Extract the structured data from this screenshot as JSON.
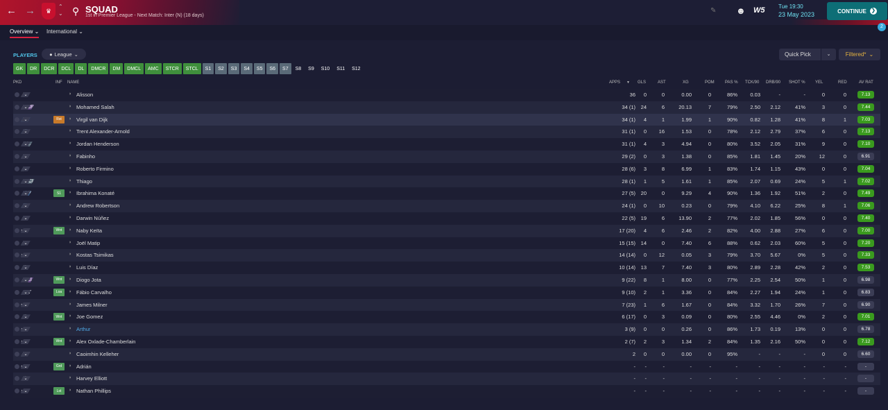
{
  "header": {
    "title": "SQUAD",
    "subtitle": "1st in Premier League - Next Match: Inter (N) (18 days)",
    "time": "Tue 19:30",
    "date": "23 May 2023",
    "continue_label": "CONTINUE",
    "brand_label": "W5",
    "notification_count": "2",
    "back_icon": "arrow-left-icon",
    "forward_icon": "arrow-right-icon"
  },
  "tabs": [
    {
      "label": "Overview ⌄"
    },
    {
      "label": "International ⌄"
    }
  ],
  "toolbar": {
    "players_label": "PLAYERS",
    "league_label": "League",
    "quick_pick_label": "Quick Pick",
    "filtered_label": "Filtered*"
  },
  "position_filters": [
    "GK",
    "DR",
    "DCR",
    "DCL",
    "DL",
    "DMCR",
    "DM",
    "DMCL",
    "AMC",
    "STCR",
    "STCL",
    "S1",
    "S2",
    "S3",
    "S4",
    "S5",
    "S6",
    "S7",
    "S8",
    "S9",
    "S10",
    "S11",
    "S12"
  ],
  "columns": {
    "pkd": "PKD",
    "inf": "INF",
    "name": "NAME",
    "apps": "APPS",
    "gls": "GLS",
    "ast": "AST",
    "xg": "XG",
    "pom": "POM",
    "pas": "PAS %",
    "tck": "TCK/90",
    "drb": "DRB/90",
    "shot": "SHOT %",
    "yel": "YEL",
    "red": "RED",
    "avrat": "AV RAT"
  },
  "colors": {
    "green": "#3f8f3c",
    "grey": "#5a6a78",
    "rating_high": "#3a9a1e",
    "rating_low": "#3b3d55",
    "accent": "#d8213f"
  },
  "players": [
    {
      "pkd": "GK",
      "pk_color": "#6b6150",
      "inf": "",
      "name": "Alisson",
      "apps": "36",
      "gls": "0",
      "ast": "0",
      "xg": "0.00",
      "pom": "0",
      "pas": "86%",
      "tck": "0.03",
      "drb": "-",
      "shot": "-",
      "yel": "0",
      "red": "0",
      "rat": "7.13",
      "hi": true
    },
    {
      "pkd": "STCR",
      "pk_color": "#6a4f8a",
      "inf": "",
      "name": "Mohamed Salah",
      "apps": "34 (1)",
      "gls": "24",
      "ast": "6",
      "xg": "20.13",
      "pom": "7",
      "pas": "79%",
      "tck": "2.50",
      "drb": "2.12",
      "shot": "41%",
      "yel": "3",
      "red": "0",
      "rat": "7.44",
      "hi": true
    },
    {
      "pkd": "DCL",
      "pk_color": "#3d6fa3",
      "inf": "Rst",
      "inf_color": "#c87a2a",
      "name": "Virgil van Dijk",
      "apps": "34 (1)",
      "gls": "4",
      "ast": "1",
      "xg": "1.99",
      "pom": "1",
      "pas": "90%",
      "tck": "0.82",
      "drb": "1.28",
      "shot": "41%",
      "yel": "8",
      "red": "1",
      "rat": "7.03",
      "hi": true,
      "sel": true
    },
    {
      "pkd": "DR",
      "pk_color": "#3d6fa3",
      "inf": "",
      "name": "Trent Alexander-Arnold",
      "apps": "31 (1)",
      "gls": "0",
      "ast": "16",
      "xg": "1.53",
      "pom": "0",
      "pas": "78%",
      "tck": "2.12",
      "drb": "2.79",
      "shot": "37%",
      "yel": "6",
      "red": "0",
      "rat": "7.13",
      "hi": true
    },
    {
      "pkd": "DM...",
      "pk_color": "#5a6a78",
      "inf": "",
      "name": "Jordan Henderson",
      "apps": "31 (1)",
      "gls": "4",
      "ast": "3",
      "xg": "4.94",
      "pom": "0",
      "pas": "80%",
      "tck": "3.52",
      "drb": "2.05",
      "shot": "31%",
      "yel": "9",
      "red": "0",
      "rat": "7.10",
      "hi": true
    },
    {
      "pkd": "DM",
      "pk_color": "#5a6a78",
      "inf": "",
      "name": "Fabinho",
      "apps": "29 (2)",
      "gls": "0",
      "ast": "3",
      "xg": "1.38",
      "pom": "0",
      "pas": "85%",
      "tck": "1.81",
      "drb": "1.45",
      "shot": "20%",
      "yel": "12",
      "red": "0",
      "rat": "6.91",
      "hi": false
    },
    {
      "pkd": "S7",
      "pk_color": "#5a6a78",
      "inf": "",
      "name": "Roberto Firmino",
      "apps": "28 (6)",
      "gls": "3",
      "ast": "8",
      "xg": "6.99",
      "pom": "1",
      "pas": "83%",
      "tck": "1.74",
      "drb": "1.15",
      "shot": "43%",
      "yel": "0",
      "red": "0",
      "rat": "7.04",
      "hi": true
    },
    {
      "pkd": "DMCL",
      "pk_color": "#5a6a78",
      "inf": "",
      "name": "Thiago",
      "apps": "28 (1)",
      "gls": "1",
      "ast": "5",
      "xg": "1.61",
      "pom": "1",
      "pas": "85%",
      "tck": "2.07",
      "drb": "0.69",
      "shot": "24%",
      "yel": "5",
      "red": "1",
      "rat": "7.02",
      "hi": true
    },
    {
      "pkd": "DCR",
      "pk_color": "#3d6fa3",
      "inf": "S1",
      "inf_color": "#4f9a5a",
      "name": "Ibrahima Konaté",
      "apps": "27 (5)",
      "gls": "20",
      "ast": "0",
      "xg": "9.29",
      "pom": "4",
      "pas": "90%",
      "tck": "1.36",
      "drb": "1.92",
      "shot": "51%",
      "yel": "2",
      "red": "0",
      "rat": "7.49",
      "hi": true
    },
    {
      "pkd": "DL",
      "pk_color": "#3d6fa3",
      "inf": "",
      "name": "Andrew Robertson",
      "apps": "24 (1)",
      "gls": "0",
      "ast": "10",
      "xg": "0.23",
      "pom": "0",
      "pas": "79%",
      "tck": "4.10",
      "drb": "6.22",
      "shot": "25%",
      "yel": "8",
      "red": "1",
      "rat": "7.06",
      "hi": true
    },
    {
      "pkd": "S4",
      "pk_color": "#5a6a78",
      "inf": "",
      "name": "Darwin Núñez",
      "apps": "22 (5)",
      "gls": "19",
      "ast": "6",
      "xg": "13.90",
      "pom": "2",
      "pas": "77%",
      "tck": "2.02",
      "drb": "1.85",
      "shot": "56%",
      "yel": "0",
      "red": "0",
      "rat": "7.40",
      "hi": true
    },
    {
      "pkd": "-",
      "pk_color": "#3a3c52",
      "inf": "Wnt",
      "inf_color": "#4f9a5a",
      "name": "Naby Keïta",
      "apps": "17 (20)",
      "gls": "4",
      "ast": "6",
      "xg": "2.46",
      "pom": "2",
      "pas": "82%",
      "tck": "4.00",
      "drb": "2.88",
      "shot": "27%",
      "yel": "6",
      "red": "0",
      "rat": "7.00",
      "hi": true
    },
    {
      "pkd": "S2",
      "pk_color": "#5a6a78",
      "inf": "",
      "name": "Joël Matip",
      "apps": "15 (15)",
      "gls": "14",
      "ast": "0",
      "xg": "7.40",
      "pom": "6",
      "pas": "88%",
      "tck": "0.62",
      "drb": "2.03",
      "shot": "60%",
      "yel": "5",
      "red": "0",
      "rat": "7.20",
      "hi": true
    },
    {
      "pkd": "-",
      "pk_color": "#3a3c52",
      "inf": "",
      "name": "Kostas Tsimikas",
      "apps": "14 (14)",
      "gls": "0",
      "ast": "12",
      "xg": "0.05",
      "pom": "3",
      "pas": "79%",
      "tck": "3.70",
      "drb": "5.67",
      "shot": "0%",
      "yel": "5",
      "red": "0",
      "rat": "7.33",
      "hi": true
    },
    {
      "pkd": "S3",
      "pk_color": "#5a6a78",
      "inf": "",
      "name": "Luis Díaz",
      "apps": "10 (14)",
      "gls": "13",
      "ast": "7",
      "xg": "7.40",
      "pom": "3",
      "pas": "80%",
      "tck": "2.89",
      "drb": "2.28",
      "shot": "42%",
      "yel": "2",
      "red": "0",
      "rat": "7.53",
      "hi": true
    },
    {
      "pkd": "STCL",
      "pk_color": "#6a4f8a",
      "inf": "Wnt",
      "inf_color": "#4f9a5a",
      "name": "Diogo Jota",
      "apps": "9 (22)",
      "gls": "8",
      "ast": "1",
      "xg": "8.00",
      "pom": "0",
      "pas": "77%",
      "tck": "2.25",
      "drb": "2.54",
      "shot": "50%",
      "yel": "1",
      "red": "0",
      "rat": "6.98",
      "hi": false
    },
    {
      "pkd": "AMC",
      "pk_color": "#3a3c52",
      "inf": "Loa",
      "inf_color": "#4f9a5a",
      "name": "Fábio Carvalho",
      "apps": "9 (10)",
      "gls": "2",
      "ast": "1",
      "xg": "3.36",
      "pom": "0",
      "pas": "84%",
      "tck": "2.27",
      "drb": "1.94",
      "shot": "24%",
      "yel": "1",
      "red": "0",
      "rat": "6.83",
      "hi": false
    },
    {
      "pkd": "-",
      "pk_color": "#3a3c52",
      "inf": "",
      "name": "James Milner",
      "apps": "7 (23)",
      "gls": "1",
      "ast": "6",
      "xg": "1.67",
      "pom": "0",
      "pas": "84%",
      "tck": "3.32",
      "drb": "1.70",
      "shot": "26%",
      "yel": "7",
      "red": "0",
      "rat": "6.90",
      "hi": false
    },
    {
      "pkd": "S5",
      "pk_color": "#5a6a78",
      "inf": "Wnt",
      "inf_color": "#4f9a5a",
      "name": "Joe Gomez",
      "apps": "6 (17)",
      "gls": "0",
      "ast": "3",
      "xg": "0.09",
      "pom": "0",
      "pas": "80%",
      "tck": "2.55",
      "drb": "4.46",
      "shot": "0%",
      "yel": "2",
      "red": "0",
      "rat": "7.01",
      "hi": true
    },
    {
      "pkd": "-",
      "pk_color": "#3a3c52",
      "inf": "",
      "name": "Arthur",
      "name_blue": true,
      "apps": "3 (9)",
      "gls": "0",
      "ast": "0",
      "xg": "0.26",
      "pom": "0",
      "pas": "86%",
      "tck": "1.73",
      "drb": "0.19",
      "shot": "13%",
      "yel": "0",
      "red": "0",
      "rat": "6.78",
      "hi": false
    },
    {
      "pkd": "-",
      "pk_color": "#3a3c52",
      "inf": "Wnt",
      "inf_color": "#4f9a5a",
      "name": "Alex Oxlade-Chamberlain",
      "apps": "2 (7)",
      "gls": "2",
      "ast": "3",
      "xg": "1.34",
      "pom": "2",
      "pas": "84%",
      "tck": "1.35",
      "drb": "2.16",
      "shot": "50%",
      "yel": "0",
      "red": "0",
      "rat": "7.12",
      "hi": true
    },
    {
      "pkd": "S1",
      "pk_color": "#5a6a78",
      "inf": "",
      "name": "Caoimhin Kelleher",
      "apps": "2",
      "gls": "0",
      "ast": "0",
      "xg": "0.00",
      "pom": "0",
      "pas": "95%",
      "tck": "-",
      "drb": "-",
      "shot": "-",
      "yel": "0",
      "red": "0",
      "rat": "6.60",
      "hi": false
    },
    {
      "pkd": "-",
      "pk_color": "#3a3c52",
      "inf": "Grd",
      "inf_color": "#4f9a5a",
      "name": "Adrián",
      "apps": "-",
      "gls": "-",
      "ast": "-",
      "xg": "-",
      "pom": "-",
      "pas": "-",
      "tck": "-",
      "drb": "-",
      "shot": "-",
      "yel": "-",
      "red": "-",
      "rat": "-",
      "hi": false
    },
    {
      "pkd": "S6",
      "pk_color": "#5a6a78",
      "inf": "",
      "name": "Harvey Elliott",
      "apps": "-",
      "gls": "-",
      "ast": "-",
      "xg": "-",
      "pom": "-",
      "pas": "-",
      "tck": "-",
      "drb": "-",
      "shot": "-",
      "yel": "-",
      "red": "-",
      "rat": "-",
      "hi": false
    },
    {
      "pkd": "-",
      "pk_color": "#3a3c52",
      "inf": "Lst",
      "inf_color": "#4f9a5a",
      "name": "Nathan Phillips",
      "apps": "-",
      "gls": "-",
      "ast": "-",
      "xg": "-",
      "pom": "-",
      "pas": "-",
      "tck": "-",
      "drb": "-",
      "shot": "-",
      "yel": "-",
      "red": "-",
      "rat": "-",
      "hi": false
    }
  ]
}
